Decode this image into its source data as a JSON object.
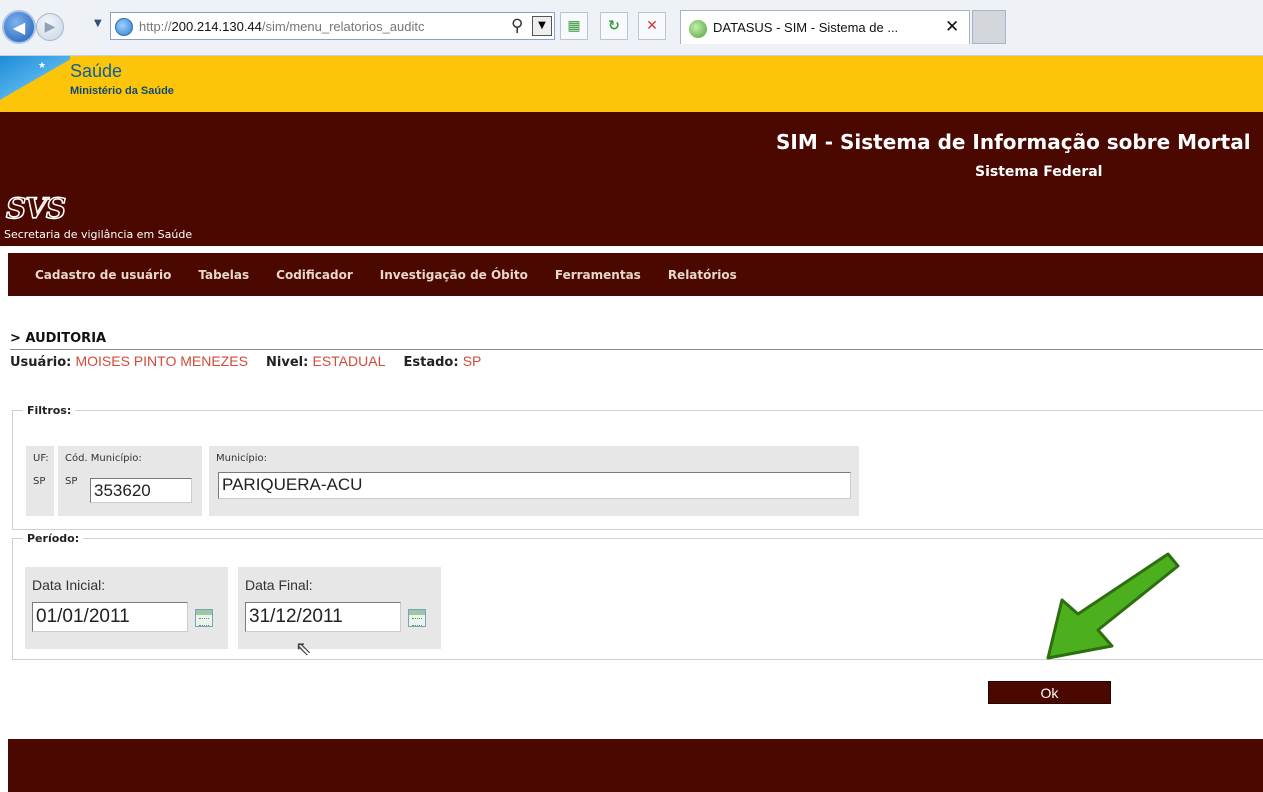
{
  "browser": {
    "url_prefix": "http://",
    "url_host": "200.214.130.44",
    "url_path": "/sim/menu_relatorios_auditc",
    "tab_title": "DATASUS - SIM - Sistema de ...",
    "tab_close": "✕"
  },
  "gov": {
    "title": "Saúde",
    "subtitle": "Ministério da Saúde"
  },
  "site": {
    "title": "SIM - Sistema de Informação sobre Mortal",
    "subtitle": "Sistema Federal",
    "logo_text": "SVS",
    "logo_subtitle": "Secretaria de vigilância em Saúde"
  },
  "nav": [
    {
      "label": "Cadastro de usuário"
    },
    {
      "label": "Tabelas"
    },
    {
      "label": "Codificador"
    },
    {
      "label": "Investigação de Óbito"
    },
    {
      "label": "Ferramentas"
    },
    {
      "label": "Relatórios"
    }
  ],
  "page": {
    "heading": "> AUDITORIA",
    "user_label": "Usuário:",
    "user_value": "MOISES PINTO MENEZES",
    "level_label": "Nivel:",
    "level_value": "ESTADUAL",
    "state_label": "Estado:",
    "state_value": "SP"
  },
  "filters": {
    "legend": "Filtros:",
    "uf_label": "UF:",
    "uf_value": "SP",
    "cod_label": "Cód. Município:",
    "cod_value": "353620",
    "mun_label": "Município:",
    "mun_value": "PARIQUERA-ACU"
  },
  "periodo": {
    "legend": "Período:",
    "start_label": "Data Inicial:",
    "start_value": "01/01/2011",
    "end_label": "Data Final:",
    "end_value": "31/12/2011"
  },
  "actions": {
    "ok_label": "Ok"
  },
  "icons": {
    "calendar": "calendar-icon",
    "cursor": "mouse-cursor-icon",
    "annotation": "green-arrow-icon"
  },
  "colors": {
    "maroon": "#4b0800",
    "gov_yellow": "#fdc50a",
    "value_red": "#d24a3a",
    "arrow_green": "#4caf1e"
  }
}
